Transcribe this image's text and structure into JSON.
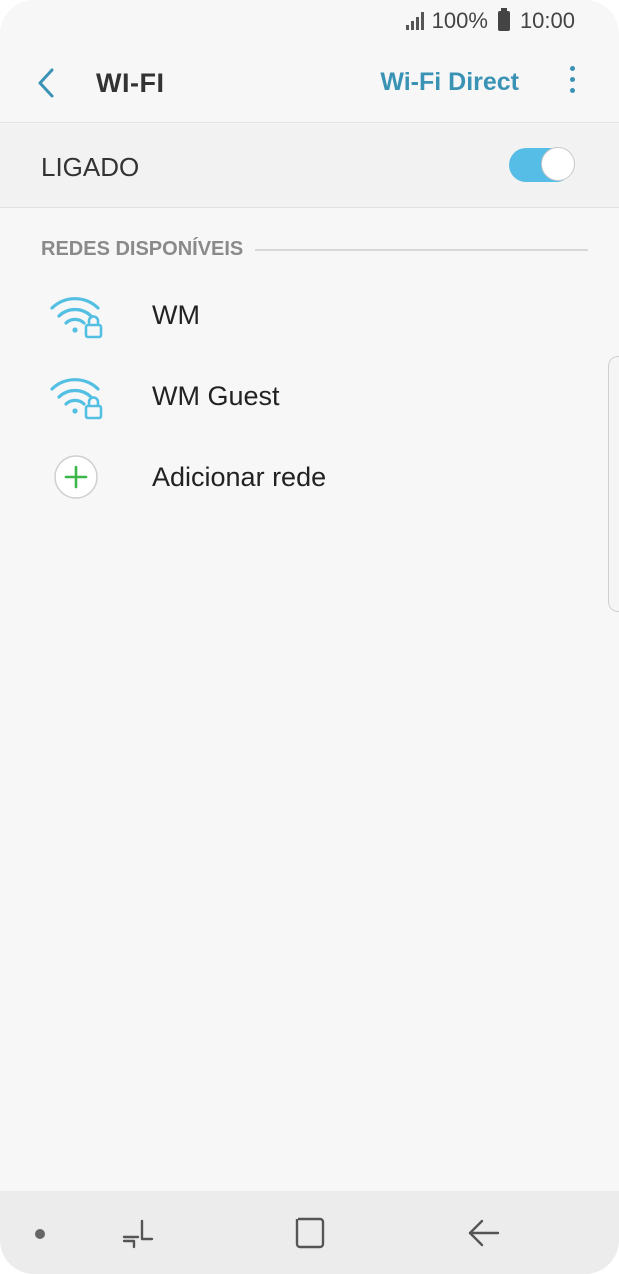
{
  "status": {
    "battery_text": "100%",
    "time": "10:00"
  },
  "appbar": {
    "title": "WI-FI",
    "wifi_direct_label": "Wi-Fi Direct"
  },
  "toggle_row": {
    "label": "LIGADO",
    "enabled": true
  },
  "section": {
    "title": "REDES DISPONÍVEIS"
  },
  "networks": [
    {
      "label": "WM",
      "icon": "wifi-locked-icon"
    },
    {
      "label": "WM Guest",
      "icon": "wifi-locked-icon"
    }
  ],
  "add_network": {
    "label": "Adicionar rede",
    "icon": "add-circle-icon"
  },
  "colors": {
    "accent": "#3a93b5",
    "toggle_on": "#55bde6",
    "wifi_icon": "#52bfe3",
    "add_icon": "#3ab64a"
  }
}
